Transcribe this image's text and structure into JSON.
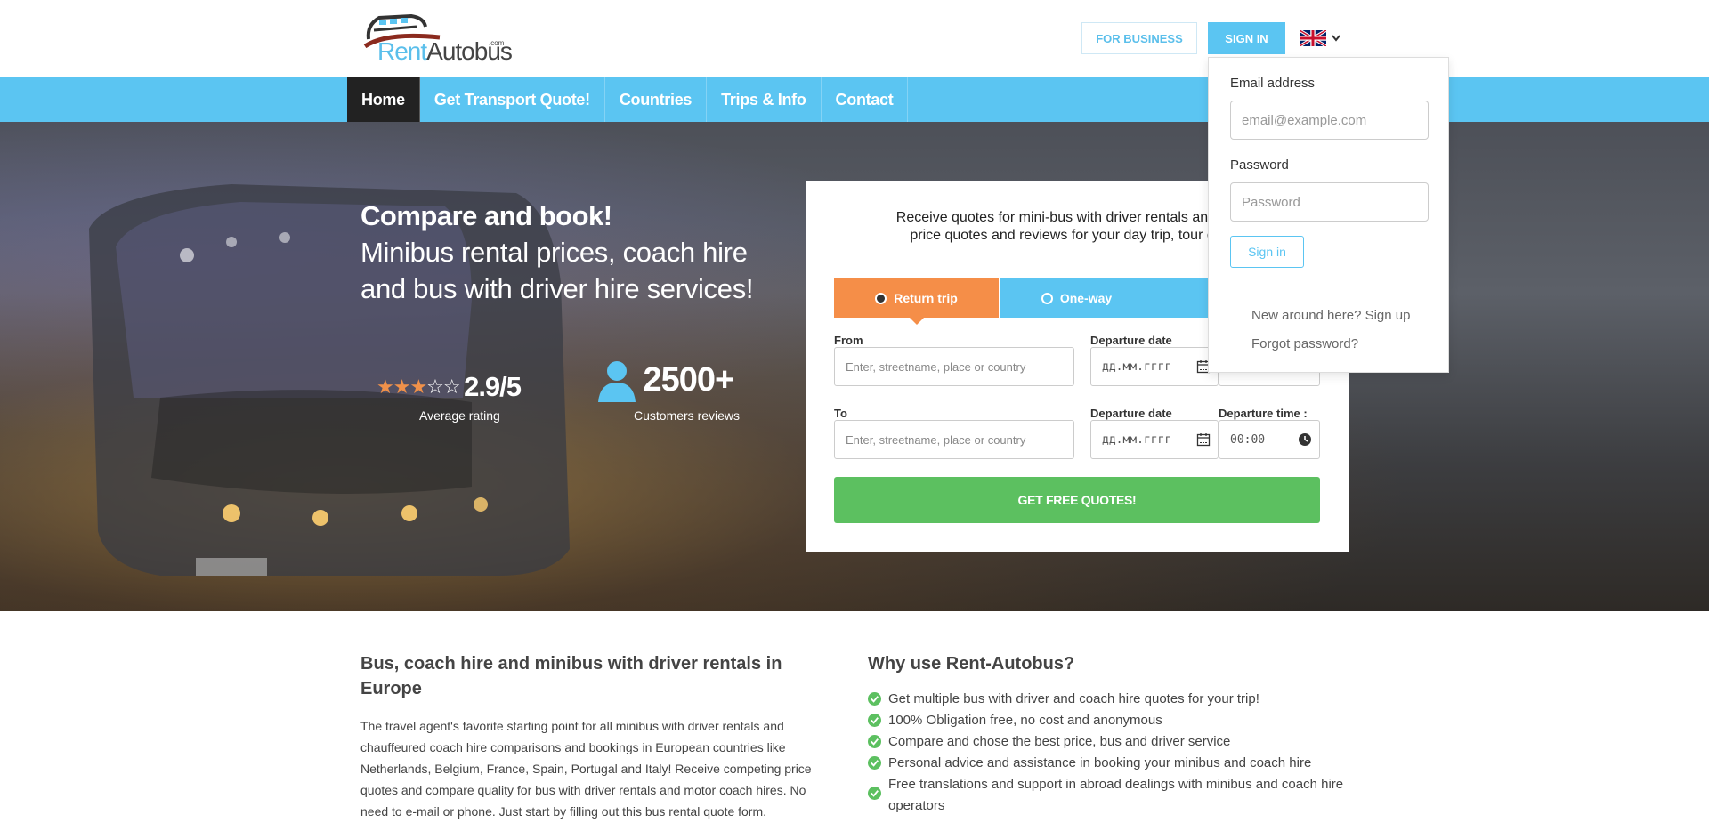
{
  "header": {
    "logo_rent": "Rent",
    "logo_autobus": "Autobus",
    "logo_com": ".com",
    "for_business": "FOR BUSINESS",
    "sign_in": "SIGN IN",
    "language": "English (UK)"
  },
  "nav": {
    "items": [
      "Home",
      "Get Transport Quote!",
      "Countries",
      "Trips & Info",
      "Contact"
    ],
    "active": "Home"
  },
  "hero": {
    "title": "Compare and book!",
    "subtitle": "Minibus rental prices, coach hire and bus with driver hire services!",
    "rating": {
      "stars_filled": 3,
      "stars_total": 5,
      "value": "2.9/5",
      "label": "Average rating"
    },
    "reviews": {
      "value": "2500+",
      "label": "Customers reviews"
    }
  },
  "quote_form": {
    "title_line1": "Receive quotes for mini-bus with driver rentals and coach",
    "title_line2": "price quotes and reviews for your day trip, tour or gro",
    "tabs": [
      "Return trip",
      "One-way",
      ""
    ],
    "active_tab": "Return trip",
    "from_label": "From",
    "from_placeholder": "Enter, streetname, place or country",
    "to_label": "To",
    "to_placeholder": "Enter, streetname, place or country",
    "departure_date_label": "Departure date",
    "date_placeholder": "дд.мм.гггг",
    "departure_time_label": "Departure time :",
    "time_value": "00:00",
    "submit": "GET FREE QUOTES!"
  },
  "signin_dropdown": {
    "email_label": "Email address",
    "email_placeholder": "email@example.com",
    "password_label": "Password",
    "password_placeholder": "Password",
    "sign_in": "Sign in",
    "signup_link": "New around here? Sign up",
    "forgot_link": "Forgot password?"
  },
  "left_section": {
    "heading": "Bus, coach hire and minibus with driver rentals in Europe",
    "body": "The travel agent's favorite starting point for all minibus with driver rentals and chauffeured coach hire comparisons and bookings in European countries like Netherlands, Belgium, France, Spain, Portugal and Italy! Receive competing price quotes and compare quality for bus with driver rentals and motor coach hires. No need to e-mail or phone. Just start by filling out this bus rental quote form."
  },
  "right_section": {
    "heading": "Why use Rent-Autobus?",
    "features": [
      "Get multiple bus with driver and coach hire quotes for your trip!",
      "100% Obligation free, no cost and anonymous",
      "Compare and chose the best price, bus and driver service",
      "Personal advice and assistance in booking your minibus and coach hire",
      "Free translations and support in abroad dealings with minibus and coach hire operators"
    ]
  },
  "colors": {
    "accent": "#5bc5f2",
    "orange": "#f58e48",
    "green": "#5cc060"
  }
}
